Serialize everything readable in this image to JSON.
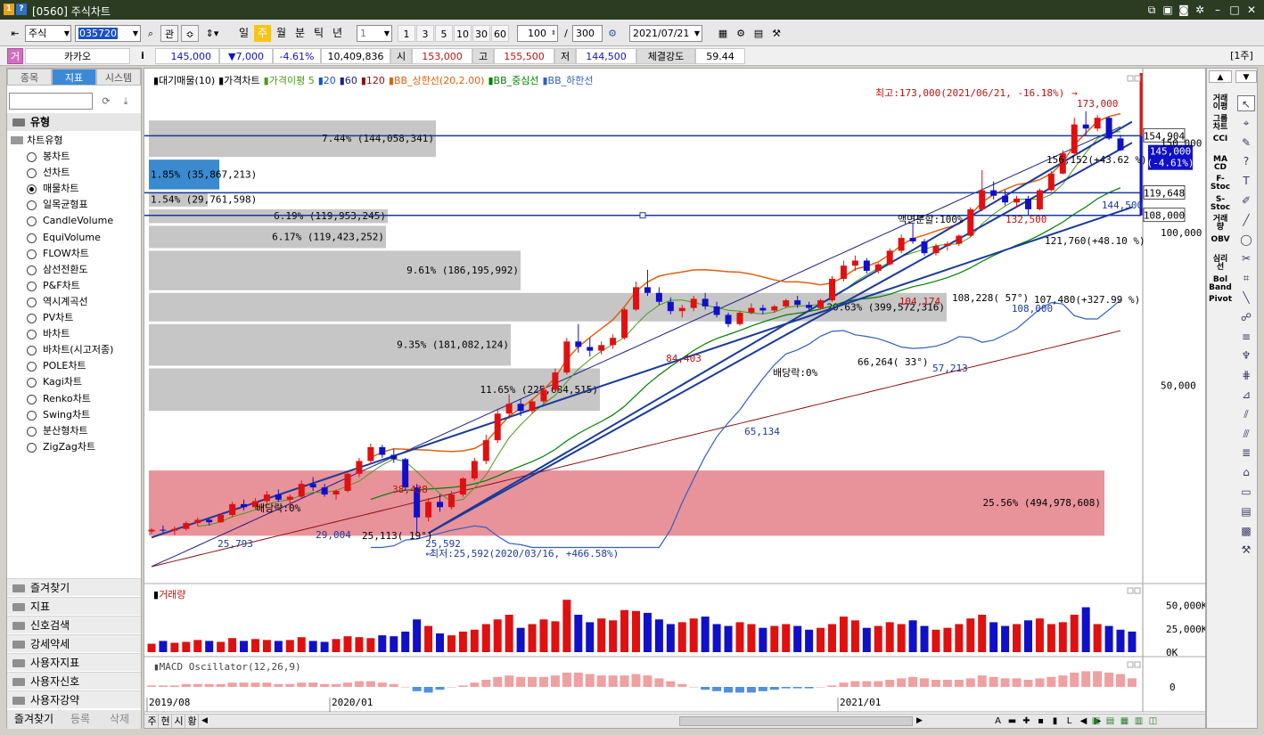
{
  "window": {
    "title": "[0560] 주식차트",
    "icon1": "1",
    "icon2": "?"
  },
  "toolbar": {
    "market": "주식",
    "code": "035720",
    "rel_label": "관",
    "periods": [
      "일",
      "주",
      "월",
      "분",
      "틱",
      "년"
    ],
    "active_period": "주",
    "interval": "1",
    "quick": [
      "1",
      "3",
      "5",
      "10",
      "30",
      "60"
    ],
    "count": "100",
    "slash": "/",
    "total": "300",
    "date": "2021/07/21"
  },
  "quote": {
    "badge": "거",
    "name": "카카오",
    "info": "i",
    "price": "145,000",
    "change": "▼7,000",
    "rate": "-4.61%",
    "volume": "10,409,836",
    "open_label": "시",
    "open": "153,000",
    "high_label": "고",
    "high": "155,500",
    "low_label": "저",
    "low": "144,500",
    "strength_label": "체결강도",
    "strength": "59.44",
    "unit": "[1주]"
  },
  "left_panel": {
    "tabs": [
      "종목",
      "지표",
      "시스템"
    ],
    "active_tab": "지표",
    "section_title": "유형",
    "tree_title": "차트유형",
    "chart_types": [
      "봉차트",
      "선차트",
      "매물차트",
      "일목균형표",
      "CandleVolume",
      "EquiVolume",
      "FLOW차트",
      "삼선전환도",
      "P&F차트",
      "역시계곡선",
      "PV차트",
      "바차트",
      "바차트(시고저종)",
      "POLE차트",
      "Kagi차트",
      "Renko차트",
      "Swing차트",
      "분산형차트",
      "ZigZag차트"
    ],
    "selected_type": "매물차트",
    "sections": [
      "즐겨찾기",
      "지표",
      "신호검색",
      "강세약세",
      "사용자지표",
      "사용자신호",
      "사용자강약"
    ],
    "bottom_tabs": [
      "즐겨찾기",
      "등록",
      "삭제"
    ]
  },
  "legend": {
    "items": [
      {
        "label": "대기매물(10)",
        "color": "#000000"
      },
      {
        "label": "가격차트",
        "color": "#000000"
      },
      {
        "label": "가격이평 5",
        "color": "#4a9a1a"
      },
      {
        "label": "20",
        "color": "#1a50c8"
      },
      {
        "label": "60",
        "color": "#1a2080"
      },
      {
        "label": "120",
        "color": "#8a1010"
      },
      {
        "label": "BB_상한선(20,2.00)",
        "color": "#e06010"
      },
      {
        "label": "BB_중심선",
        "color": "#008000"
      },
      {
        "label": "BB_하한선",
        "color": "#3060c0"
      }
    ]
  },
  "chart_data": [
    {
      "type": "candlestick",
      "title": "가격차트",
      "x_ticks": [
        "2019/08",
        "2020/01",
        "2021/01"
      ],
      "y_ticks": [
        "150,000",
        "100,000",
        "50,000"
      ],
      "scale": "log",
      "volume_profile": [
        {
          "label": "7.44% (144,058,341)",
          "pct": 7.44
        },
        {
          "label": "1.85% (35,867,213)",
          "pct": 1.85
        },
        {
          "label": "1.54% (29,761,598)",
          "pct": 1.54
        },
        {
          "label": "6.19% (119,953,245)",
          "pct": 6.19
        },
        {
          "label": "6.17% (119,423,252)",
          "pct": 6.17
        },
        {
          "label": "9.61% (186,195,992)",
          "pct": 9.61
        },
        {
          "label": "20.63% (399,572,316)",
          "pct": 20.63
        },
        {
          "label": "9.35% (181,082,124)",
          "pct": 9.35
        },
        {
          "label": "11.65% (225,684,515)",
          "pct": 11.65
        },
        {
          "label": "25.56% (494,978,608)",
          "pct": 25.56
        }
      ],
      "annotations": {
        "high": "최고:173,000(2021/06/21, -16.18%)",
        "high_val": "173,000",
        "low": "최저:25,592(2020/03/16, +466.58%)",
        "low_val": "25,592",
        "split": "액면분할:100%",
        "dividend1": "배당락:0%",
        "dividend2": "배당락:0%",
        "peak1": "84,403",
        "peak2": "38,438",
        "peak3": "104,174",
        "peak4": "132,500",
        "trough1": "25,793",
        "trough2": "29,004",
        "trough3": "65,134",
        "trough4": "108,000",
        "trough5": "144,500",
        "mark1": "25,113( 19°)",
        "mark2": "66,264( 33°)",
        "mark3": "57,213",
        "mark4": "108,228( 57°)",
        "mark5": "107,480(+327.99 %)",
        "mark6": "121,760(+48.10 %)",
        "mark7": "156,152(+43.62 %)",
        "line1": "154,904",
        "line2": "119,648",
        "line3": "108,000",
        "current": "145,000",
        "current_rate": "(-4.61%)"
      },
      "candles": [
        [
          25.8,
          26.2,
          25.5,
          26.0
        ],
        [
          26.0,
          26.5,
          25.6,
          25.9
        ],
        [
          25.9,
          26.4,
          25.4,
          26.1
        ],
        [
          26.1,
          27.0,
          25.9,
          26.8
        ],
        [
          26.8,
          27.5,
          26.4,
          27.2
        ],
        [
          27.2,
          27.4,
          26.5,
          26.9
        ],
        [
          26.9,
          28.0,
          26.8,
          27.8
        ],
        [
          27.8,
          29.5,
          27.5,
          29.2
        ],
        [
          29.2,
          29.8,
          28.4,
          28.8
        ],
        [
          28.8,
          30.0,
          28.5,
          29.6
        ],
        [
          29.6,
          31.0,
          29.3,
          30.5
        ],
        [
          30.5,
          31.2,
          29.5,
          29.8
        ],
        [
          29.8,
          30.5,
          29.0,
          30.2
        ],
        [
          30.2,
          32.5,
          30.0,
          32.0
        ],
        [
          32.0,
          33.0,
          31.0,
          31.5
        ],
        [
          31.5,
          32.0,
          30.2,
          30.5
        ],
        [
          30.5,
          31.2,
          29.8,
          31.0
        ],
        [
          31.0,
          34.0,
          30.8,
          33.5
        ],
        [
          33.5,
          36.0,
          33.0,
          35.5
        ],
        [
          35.5,
          38.4,
          35.0,
          37.8
        ],
        [
          37.8,
          38.2,
          36.0,
          36.5
        ],
        [
          36.5,
          37.5,
          35.2,
          35.8
        ],
        [
          35.8,
          36.0,
          31.0,
          31.5
        ],
        [
          31.5,
          32.0,
          25.6,
          27.5
        ],
        [
          27.5,
          30.0,
          27.0,
          29.5
        ],
        [
          29.5,
          30.5,
          28.2,
          28.8
        ],
        [
          28.8,
          31.0,
          28.5,
          30.5
        ],
        [
          30.5,
          33.0,
          30.2,
          32.8
        ],
        [
          32.8,
          36.0,
          32.5,
          35.5
        ],
        [
          35.5,
          40.0,
          35.0,
          39.0
        ],
        [
          39.0,
          45.0,
          38.5,
          44.0
        ],
        [
          44.0,
          48.0,
          43.0,
          46.0
        ],
        [
          46.0,
          47.0,
          43.5,
          44.5
        ],
        [
          44.5,
          47.0,
          44.0,
          46.5
        ],
        [
          46.5,
          50.0,
          46.0,
          49.0
        ],
        [
          49.0,
          54.0,
          48.5,
          53.0
        ],
        [
          53.0,
          62.0,
          52.5,
          61.0
        ],
        [
          61.0,
          66.0,
          58.0,
          59.5
        ],
        [
          59.5,
          62.0,
          57.0,
          58.5
        ],
        [
          58.5,
          61.0,
          57.5,
          60.0
        ],
        [
          60.0,
          63.0,
          59.0,
          62.0
        ],
        [
          62.0,
          71.0,
          61.5,
          70.5
        ],
        [
          70.5,
          80.0,
          70.0,
          78.0
        ],
        [
          78.0,
          84.4,
          75.0,
          76.0
        ],
        [
          76.0,
          78.0,
          72.0,
          73.0
        ],
        [
          73.0,
          74.5,
          69.0,
          70.0
        ],
        [
          70.0,
          72.0,
          68.0,
          71.0
        ],
        [
          71.0,
          75.0,
          70.0,
          74.0
        ],
        [
          74.0,
          76.0,
          70.5,
          71.5
        ],
        [
          71.5,
          73.0,
          68.0,
          68.8
        ],
        [
          68.8,
          69.5,
          65.1,
          66.0
        ],
        [
          66.0,
          70.0,
          65.5,
          69.5
        ],
        [
          69.5,
          72.5,
          69.0,
          71.0
        ],
        [
          71.0,
          72.0,
          69.0,
          70.2
        ],
        [
          70.2,
          72.0,
          69.5,
          71.5
        ],
        [
          71.5,
          74.0,
          71.0,
          73.5
        ],
        [
          73.5,
          75.0,
          71.0,
          72.0
        ],
        [
          72.0,
          73.0,
          70.0,
          71.0
        ],
        [
          71.0,
          74.0,
          70.5,
          73.5
        ],
        [
          73.5,
          82.0,
          73.0,
          81.0
        ],
        [
          81.0,
          88.0,
          80.0,
          86.0
        ],
        [
          86.0,
          90.0,
          84.0,
          88.0
        ],
        [
          88.0,
          89.0,
          83.0,
          84.0
        ],
        [
          84.0,
          87.0,
          83.0,
          86.5
        ],
        [
          86.5,
          93.0,
          86.0,
          92.0
        ],
        [
          92.0,
          99.0,
          91.0,
          97.5
        ],
        [
          97.5,
          104.2,
          95.0,
          96.0
        ],
        [
          96.0,
          97.0,
          90.0,
          91.0
        ],
        [
          91.0,
          95.0,
          90.0,
          94.0
        ],
        [
          94.0,
          96.0,
          92.0,
          95.0
        ],
        [
          95.0,
          99.0,
          94.0,
          98.5
        ],
        [
          98.5,
          112.0,
          98.0,
          111.0
        ],
        [
          111.0,
          132.5,
          110.0,
          121.0
        ],
        [
          121.0,
          126.0,
          116.0,
          118.0
        ],
        [
          118.0,
          121.0,
          113.0,
          114.5
        ],
        [
          114.5,
          118.0,
          112.0,
          116.5
        ],
        [
          116.5,
          118.0,
          108.0,
          111.0
        ],
        [
          111.0,
          122.0,
          110.5,
          121.0
        ],
        [
          121.0,
          132.0,
          120.5,
          130.5
        ],
        [
          130.5,
          145.0,
          130.0,
          143.0
        ],
        [
          143.0,
          168.0,
          142.0,
          163.0
        ],
        [
          163.0,
          173.0,
          155.0,
          160.0
        ],
        [
          160.0,
          170.0,
          158.0,
          168.0
        ],
        [
          168.0,
          169.0,
          152.0,
          153.0
        ],
        [
          153.0,
          155.5,
          144.5,
          145.0
        ]
      ]
    },
    {
      "type": "bar",
      "title": "거래량",
      "y_ticks": [
        "50,000K",
        "25,000K",
        "0K"
      ],
      "values": [
        9,
        12,
        10,
        11,
        13,
        12,
        11,
        15,
        12,
        14,
        13,
        12,
        13,
        16,
        12,
        11,
        14,
        17,
        16,
        15,
        18,
        17,
        22,
        35,
        28,
        20,
        18,
        22,
        24,
        30,
        35,
        40,
        26,
        30,
        35,
        33,
        56,
        40,
        32,
        36,
        34,
        45,
        44,
        42,
        35,
        30,
        32,
        36,
        38,
        30,
        28,
        32,
        30,
        26,
        28,
        30,
        28,
        24,
        26,
        30,
        38,
        34,
        26,
        28,
        32,
        30,
        34,
        28,
        24,
        26,
        30,
        36,
        40,
        32,
        28,
        30,
        34,
        36,
        30,
        32,
        40,
        48,
        30,
        28,
        24,
        22
      ],
      "colors_up": "#e01010",
      "colors_down": "#1010c8"
    },
    {
      "type": "bar",
      "title": "MACD Oscillator(12,26,9)",
      "y_ticks": [
        "0"
      ],
      "values": [
        1,
        1,
        1,
        2,
        2,
        2,
        2,
        3,
        3,
        3,
        3,
        2,
        2,
        3,
        3,
        2,
        2,
        3,
        4,
        4,
        3,
        2,
        0,
        -3,
        -4,
        -2,
        0,
        1,
        3,
        5,
        7,
        8,
        7,
        7,
        7,
        8,
        10,
        10,
        9,
        8,
        8,
        8,
        9,
        8,
        6,
        4,
        2,
        0,
        -2,
        -3,
        -4,
        -4,
        -4,
        -3,
        -2,
        -1,
        -1,
        -1,
        0,
        1,
        3,
        4,
        4,
        4,
        5,
        6,
        7,
        6,
        5,
        5,
        5,
        6,
        8,
        7,
        6,
        6,
        5,
        6,
        7,
        8,
        10,
        11,
        11,
        10,
        9,
        6
      ]
    }
  ],
  "volume_panel": {
    "title": "거래량"
  },
  "macd_panel": {
    "title": "MACD Oscillator(12,26,9)"
  },
  "bottom_bar": {
    "tabs": [
      "주",
      "현",
      "시",
      "황"
    ]
  },
  "right_tools": [
    "거래\n이평",
    "그룹\n차트",
    "CCI",
    "MA\nCD",
    "F-\nStoc",
    "S-\nStoc",
    "거래\n량",
    "OBV",
    "심리\n선",
    "Bol\nBand",
    "Pivot"
  ]
}
